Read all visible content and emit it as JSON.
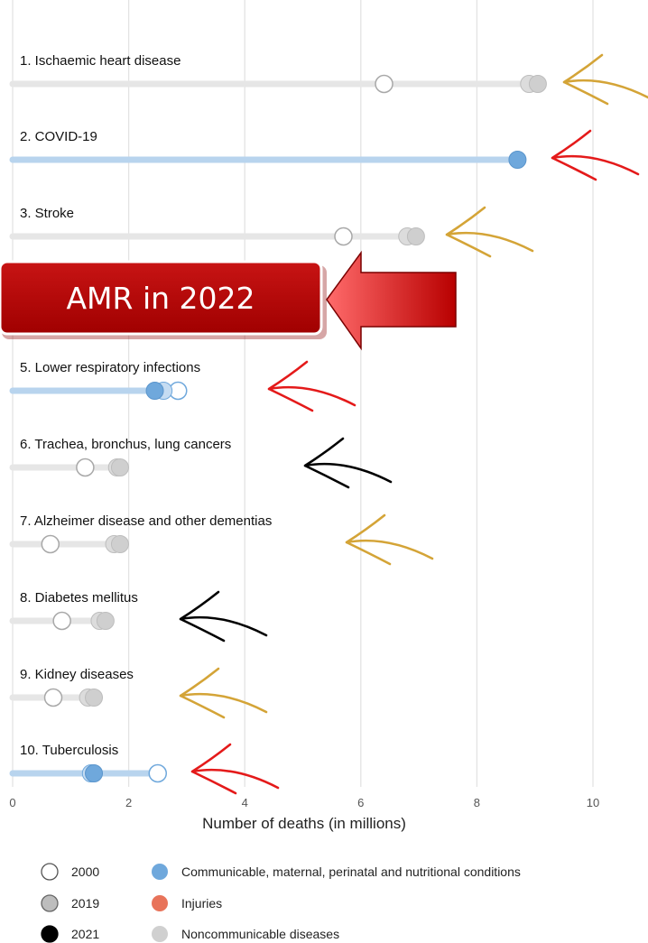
{
  "chart_data": {
    "type": "dot-range",
    "xlabel": "Number of deaths (in millions)",
    "xlim": [
      0,
      11
    ],
    "xticks": [
      0,
      2,
      4,
      6,
      8,
      10
    ],
    "grid": true,
    "categories": [
      {
        "rank": 1,
        "label": "1. Ischaemic heart disease",
        "group": "Noncommunicable diseases",
        "y2000": 6.4,
        "y2019": 8.9,
        "y2021": 9.05
      },
      {
        "rank": 2,
        "label": "2. COVID-19",
        "group": "Communicable, maternal, perinatal and nutritional conditions",
        "y2000": null,
        "y2019": null,
        "y2021": 8.7
      },
      {
        "rank": 3,
        "label": "3. Stroke",
        "group": "Noncommunicable diseases",
        "y2000": 5.7,
        "y2019": 6.8,
        "y2021": 6.95
      },
      {
        "rank": 5,
        "label": "5. Lower respiratory infections",
        "group": "Communicable, maternal, perinatal and nutritional conditions",
        "y2000": 2.85,
        "y2019": 2.6,
        "y2021": 2.45
      },
      {
        "rank": 6,
        "label": "6. Trachea, bronchus, lung cancers",
        "group": "Noncommunicable diseases",
        "y2000": 1.25,
        "y2019": 1.8,
        "y2021": 1.85
      },
      {
        "rank": 7,
        "label": "7. Alzheimer disease and other dementias",
        "group": "Noncommunicable diseases",
        "y2000": 0.65,
        "y2019": 1.75,
        "y2021": 1.85
      },
      {
        "rank": 8,
        "label": "8. Diabetes mellitus",
        "group": "Noncommunicable diseases",
        "y2000": 0.85,
        "y2019": 1.5,
        "y2021": 1.6
      },
      {
        "rank": 9,
        "label": "9. Kidney diseases",
        "group": "Noncommunicable diseases",
        "y2000": 0.7,
        "y2019": 1.3,
        "y2021": 1.4
      },
      {
        "rank": 10,
        "label": "10. Tuberculosis",
        "group": "Communicable, maternal, perinatal and nutritional conditions",
        "y2000": 2.5,
        "y2019": 1.35,
        "y2021": 1.4
      }
    ],
    "legend": {
      "years": [
        {
          "label": "2000",
          "style": "hollow"
        },
        {
          "label": "2019",
          "style": "gray"
        },
        {
          "label": "2021",
          "style": "black"
        }
      ],
      "groups": [
        {
          "label": "Communicable, maternal, perinatal and nutritional conditions",
          "color": "#6fa8dc"
        },
        {
          "label": "Injuries",
          "color": "#e8735a"
        },
        {
          "label": "Noncommunicable diseases",
          "color": "#d0d0d0"
        }
      ]
    },
    "callout": {
      "text": "AMR in 2022",
      "color": "#c00000"
    },
    "arrows": [
      {
        "rank": 1,
        "color": "#d4a437"
      },
      {
        "rank": 2,
        "color": "#e41a1a"
      },
      {
        "rank": 3,
        "color": "#d4a437"
      },
      {
        "rank": 5,
        "color": "#e41a1a"
      },
      {
        "rank": 6,
        "color": "#000000"
      },
      {
        "rank": 7,
        "color": "#d4a437"
      },
      {
        "rank": 8,
        "color": "#000000"
      },
      {
        "rank": 9,
        "color": "#d4a437"
      },
      {
        "rank": 10,
        "color": "#e41a1a"
      }
    ]
  },
  "colors": {
    "communicable_bar": "#b8d4ee",
    "communicable_dot": "#6fa8dc",
    "noncommunicable_bar": "#e6e6e6",
    "noncommunicable_dot": "#cfcfcf",
    "grid": "#e3e3e3"
  }
}
